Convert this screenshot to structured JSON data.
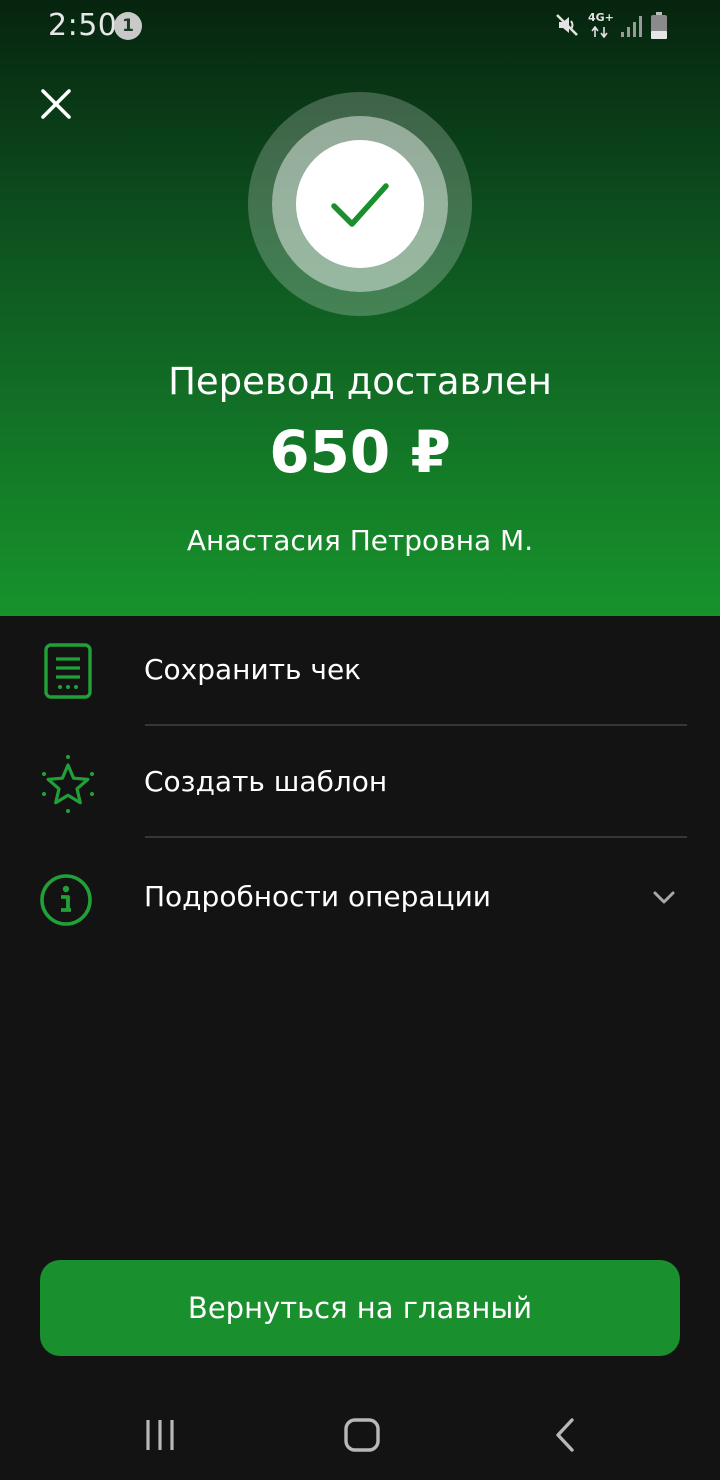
{
  "status_bar": {
    "time": "2:50",
    "notification_count": "1",
    "network_label": "4G+",
    "icons": [
      "mute-icon",
      "signal-icon",
      "battery-icon"
    ]
  },
  "header": {
    "close_icon": "close-icon",
    "status_icon": "check-icon",
    "title": "Перевод доставлен",
    "amount": "650 ₽",
    "recipient": "Анастасия Петровна М."
  },
  "actions": [
    {
      "label": "Сохранить чек",
      "icon": "receipt-icon"
    },
    {
      "label": "Создать шаблон",
      "icon": "star-icon"
    },
    {
      "label": "Подробности операции",
      "icon": "info-icon",
      "expandable": true
    }
  ],
  "primary_button": {
    "label": "Вернуться на главный"
  },
  "nav_bar": {
    "icons": [
      "recent-apps-icon",
      "home-icon",
      "back-icon"
    ]
  },
  "colors": {
    "accent": "#1a8f2e",
    "icon_green": "#21a038",
    "background": "#131313",
    "header_top": "#06240f",
    "header_bottom": "#17932b"
  }
}
